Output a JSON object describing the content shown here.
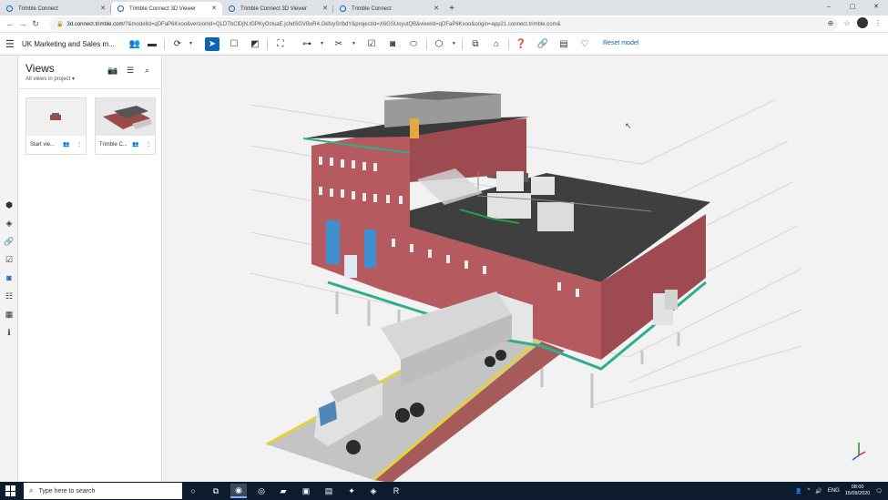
{
  "browser": {
    "tabs": [
      {
        "title": "Trimble Connect",
        "active": false
      },
      {
        "title": "Trimble Connect 3D Viewer",
        "active": true
      },
      {
        "title": "Trimble Connect 3D Viewer",
        "active": false
      },
      {
        "title": "Trimble Connect",
        "active": false
      }
    ],
    "new_tab": "+",
    "window_controls": [
      "–",
      "▢",
      "✕"
    ],
    "url_host": "3d.connect.trimble.com",
    "url_path": "/?&modelId=qDFaP6Kxoo&versionId=QLDTbClDjN.tGPKyOzluaE.jchdSGVBoR4.GkfuySrlbdY&projectId=X6GSUoyutQB&viewId=qDFaP6Kxoo&origin=app21.connect.trimble.com&"
  },
  "app": {
    "project_name": "UK Marketing and Sales m...",
    "reset_model_label": "Reset model",
    "accent_color": "#0e63b8",
    "toolbar_icons": [
      "team-icon",
      "folder-icon",
      "orbit-icon",
      "select-icon",
      "box-select-icon",
      "frame-icon",
      "section-icon",
      "measure-icon",
      "cut-icon",
      "markup-icon",
      "snapshot-icon",
      "shape-icon",
      "cube-icon",
      "clash-icon",
      "lock-icon",
      "help-icon",
      "link-icon",
      "clipboard-icon",
      "comment-icon"
    ]
  },
  "views_panel": {
    "title": "Views",
    "subtitle": "All views in project",
    "cards": [
      {
        "label": "Start vie..."
      },
      {
        "label": "Trimble C..."
      }
    ]
  },
  "left_rail_icons": [
    "objects-icon",
    "layers-icon",
    "link-icon",
    "todo-icon",
    "views-icon",
    "tree-icon",
    "table-icon",
    "info-icon"
  ],
  "taskbar": {
    "search_placeholder": "Type here to search",
    "language": "ENG",
    "time": "08:00",
    "date": "15/09/2020"
  }
}
